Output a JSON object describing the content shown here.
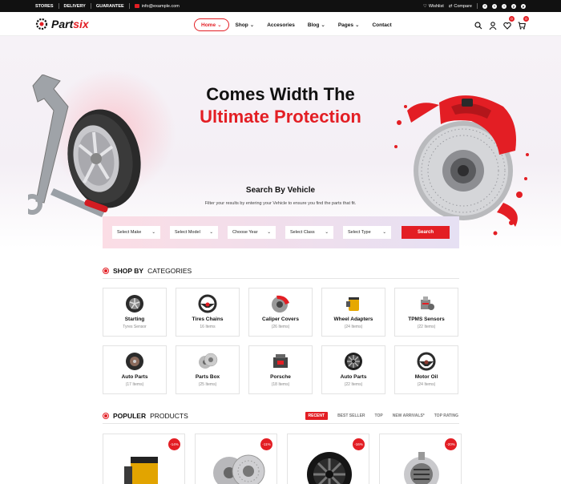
{
  "topbar": {
    "links": [
      "STORES",
      "DELIVERY",
      "GUARANTEE"
    ],
    "email": "info@example.com",
    "wishlist": "Wishlist",
    "compare": "Compare",
    "social": [
      "f",
      "t",
      "i",
      "y",
      "p"
    ]
  },
  "header": {
    "logo": {
      "part1": "Part",
      "part2": "six"
    },
    "nav": [
      {
        "label": "Home",
        "dropdown": true,
        "active": true
      },
      {
        "label": "Shop",
        "dropdown": true
      },
      {
        "label": "Accesories",
        "dropdown": false
      },
      {
        "label": "Blog",
        "dropdown": true
      },
      {
        "label": "Pages",
        "dropdown": true
      },
      {
        "label": "Contact",
        "dropdown": false
      }
    ],
    "wishlist_count": "0",
    "cart_count": "0"
  },
  "hero": {
    "title_line1": "Comes Width The",
    "title_line2": "Ultimate Protection"
  },
  "search": {
    "title": "Search By Vehicle",
    "subtitle": "Filter your results by entering your Vehicle to ensure you find the parts that fit.",
    "selects": [
      "Select Make",
      "Select Model",
      "Choose Year",
      "Select Class",
      "Select Type"
    ],
    "button": "Search"
  },
  "categories": {
    "title_bold": "SHOP BY",
    "title_rest": "CATEGORIES",
    "items": [
      {
        "name": "Starting",
        "count": "Tyres Sensor",
        "icon": "wheel-icon"
      },
      {
        "name": "Tires Chains",
        "count": "16 Items",
        "icon": "steering-wheel-icon"
      },
      {
        "name": "Caliper Covers",
        "count": "(26 Items)",
        "icon": "brake-caliper-icon"
      },
      {
        "name": "Wheel Adapters",
        "count": "(24 Items)",
        "icon": "oil-filter-icon"
      },
      {
        "name": "TPMS Sensors",
        "count": "(22 Items)",
        "icon": "engine-part-icon"
      },
      {
        "name": "Auto Parts",
        "count": "(17 Items)",
        "icon": "tire-icon"
      },
      {
        "name": "Parts Box",
        "count": "(25 Items)",
        "icon": "brake-disc-icon"
      },
      {
        "name": "Porsche",
        "count": "(18 Items)",
        "icon": "engine-icon"
      },
      {
        "name": "Auto Parts",
        "count": "(22 Items)",
        "icon": "rim-icon"
      },
      {
        "name": "Motor Oil",
        "count": "(24 Items)",
        "icon": "steering-wheel-icon"
      }
    ]
  },
  "products": {
    "title_bold": "POPULER",
    "title_rest": "PRODUCTS",
    "tabs": [
      {
        "label": "RECENT",
        "active": true
      },
      {
        "label": "BEST SELLER"
      },
      {
        "label": "TOP"
      },
      {
        "label": "NEW ARRIVALS*"
      },
      {
        "label": "TOP RATING"
      }
    ],
    "items": [
      {
        "discount": "-14%",
        "icon": "oil-filter-icon"
      },
      {
        "discount": "-11%",
        "icon": "brake-disc-icon"
      },
      {
        "discount": "-16%",
        "icon": "rim-icon"
      },
      {
        "discount": "-20%",
        "icon": "alternator-icon"
      }
    ]
  },
  "colors": {
    "accent": "#e31e24",
    "dark": "#111111"
  }
}
